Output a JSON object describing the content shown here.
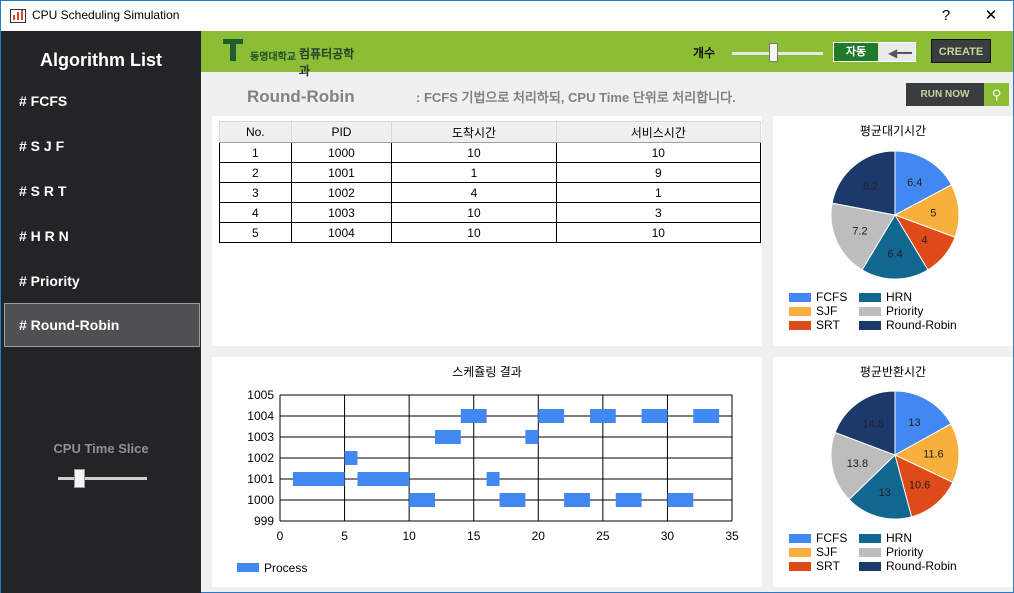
{
  "window": {
    "title": "CPU Scheduling Simulation",
    "help": "?",
    "close": "✕"
  },
  "sidebar": {
    "heading": "Algorithm List",
    "items": [
      "# FCFS",
      "# S J F",
      "# S R T",
      "# H R N",
      "# Priority",
      "# Round-Robin"
    ],
    "active": "# Round-Robin",
    "time_slice_label": "CPU Time Slice"
  },
  "topbar": {
    "logo_text": "동명대학교",
    "dept_text": "컴퓨터공학과",
    "count_label": "개수",
    "auto_label": "자동",
    "create_label": "CREATE"
  },
  "algo": {
    "name": "Round-Robin",
    "description": ": FCFS 기법으로 처리하되, CPU Time 단위로 처리합니다.",
    "run_label": "RUN NOW"
  },
  "table": {
    "headers": [
      "No.",
      "PID",
      "도착시간",
      "서비스시간"
    ],
    "rows": [
      [
        "1",
        "1000",
        "10",
        "10"
      ],
      [
        "2",
        "1001",
        "1",
        "9"
      ],
      [
        "3",
        "1002",
        "4",
        "1"
      ],
      [
        "4",
        "1003",
        "10",
        "3"
      ],
      [
        "5",
        "1004",
        "10",
        "10"
      ]
    ]
  },
  "chart_data": [
    {
      "type": "pie",
      "title": "평균대기시간",
      "labels": [
        "FCFS",
        "SJF",
        "SRT",
        "HRN",
        "Priority",
        "Round-Robin"
      ],
      "values": [
        6.4,
        5,
        4,
        6.4,
        7.2,
        8.2
      ],
      "colors": [
        "#4189f0",
        "#f8b03d",
        "#de4a18",
        "#126791",
        "#bdbdbd",
        "#1b3a6b"
      ],
      "legend": "bottom"
    },
    {
      "type": "pie",
      "title": "평균반환시간",
      "labels": [
        "FCFS",
        "SJF",
        "SRT",
        "HRN",
        "Priority",
        "Round-Robin"
      ],
      "values": [
        13,
        11.6,
        10.6,
        13,
        13.8,
        14.8
      ],
      "colors": [
        "#4189f0",
        "#f8b03d",
        "#de4a18",
        "#126791",
        "#bdbdbd",
        "#1b3a6b"
      ],
      "legend": "bottom"
    },
    {
      "type": "gantt",
      "title": "스케쥴링 결과",
      "xlim": [
        0,
        35
      ],
      "xticks": [
        0,
        5,
        10,
        15,
        20,
        25,
        30,
        35
      ],
      "ylim": [
        999,
        1005
      ],
      "yticks": [
        999,
        1000,
        1001,
        1002,
        1003,
        1004,
        1005
      ],
      "series_name": "Process",
      "color": "#4189f0",
      "bars": [
        {
          "pid": 1001,
          "start": 1,
          "end": 5
        },
        {
          "pid": 1002,
          "start": 5,
          "end": 6
        },
        {
          "pid": 1001,
          "start": 6,
          "end": 10
        },
        {
          "pid": 1000,
          "start": 10,
          "end": 12
        },
        {
          "pid": 1003,
          "start": 12,
          "end": 14
        },
        {
          "pid": 1004,
          "start": 14,
          "end": 16
        },
        {
          "pid": 1001,
          "start": 16,
          "end": 17
        },
        {
          "pid": 1000,
          "start": 17,
          "end": 19
        },
        {
          "pid": 1003,
          "start": 19,
          "end": 20
        },
        {
          "pid": 1004,
          "start": 20,
          "end": 22
        },
        {
          "pid": 1000,
          "start": 22,
          "end": 24
        },
        {
          "pid": 1004,
          "start": 24,
          "end": 26
        },
        {
          "pid": 1000,
          "start": 26,
          "end": 28
        },
        {
          "pid": 1004,
          "start": 28,
          "end": 30
        },
        {
          "pid": 1000,
          "start": 30,
          "end": 32
        },
        {
          "pid": 1004,
          "start": 32,
          "end": 34
        }
      ]
    }
  ]
}
